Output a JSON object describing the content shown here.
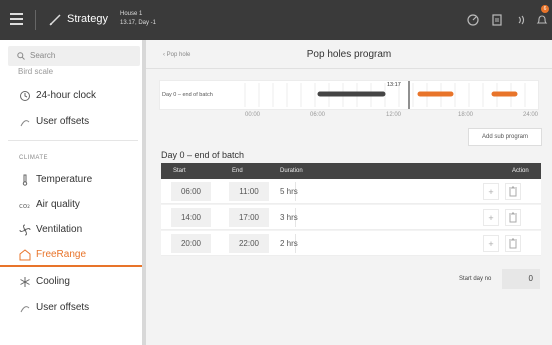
{
  "topbar": {
    "title": "Strategy",
    "house_line1": "House 1",
    "house_line2": "13.17, Day -1",
    "badge_count": "6"
  },
  "sidebar": {
    "search_placeholder": "Search",
    "cutoff_item": "Bird scale",
    "items_top": [
      {
        "label": "24-hour clock",
        "icon": "clock-icon"
      },
      {
        "label": "User offsets",
        "icon": "offsets-icon"
      }
    ],
    "section": "CLIMATE",
    "items": [
      {
        "label": "Temperature",
        "icon": "thermometer-icon"
      },
      {
        "label": "Air quality",
        "icon": "air-quality-icon"
      },
      {
        "label": "Ventilation",
        "icon": "fan-icon"
      },
      {
        "label": "FreeRange",
        "icon": "freerange-icon",
        "active": true
      },
      {
        "label": "Cooling",
        "icon": "snowflake-icon"
      },
      {
        "label": "User offsets",
        "icon": "offsets-icon"
      }
    ]
  },
  "main": {
    "back_label": "Pop hole",
    "title": "Pop holes program",
    "timeline": {
      "label": "Day 0 – end of batch",
      "now": "13:17",
      "ticks": [
        "00:00",
        "06:00",
        "12:00",
        "18:00",
        "24:00"
      ]
    },
    "add_sub_label": "Add sub program",
    "day_heading": "Day 0 – end of batch",
    "columns": {
      "start": "Start",
      "end": "End",
      "duration": "Duration",
      "action": "Action"
    },
    "rows": [
      {
        "start": "06:00",
        "end": "11:00",
        "duration": "5 hrs"
      },
      {
        "start": "14:00",
        "end": "17:00",
        "duration": "3 hrs"
      },
      {
        "start": "20:00",
        "end": "22:00",
        "duration": "2 hrs"
      }
    ],
    "start_day_label": "Start day no",
    "start_day_value": "0"
  },
  "colors": {
    "accent": "#e8742a",
    "dark": "#3a3a3a",
    "active_bar": "#444444"
  }
}
